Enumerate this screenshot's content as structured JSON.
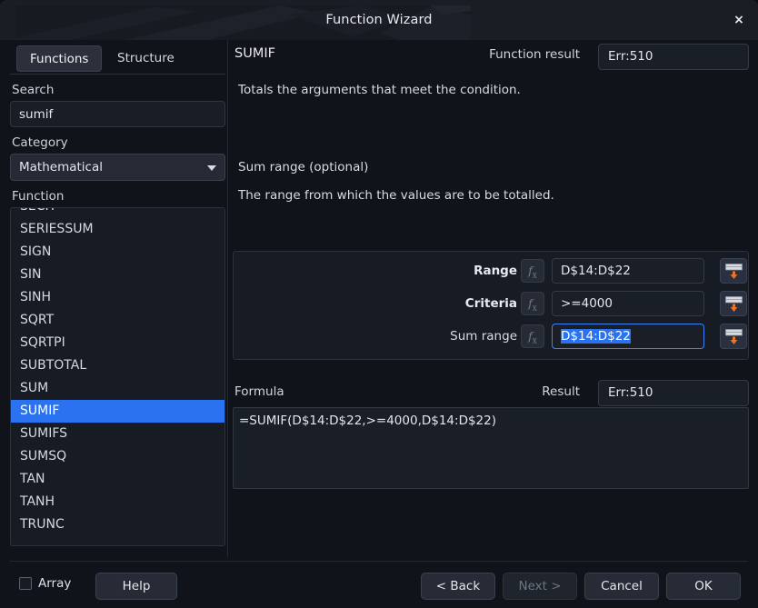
{
  "window": {
    "title": "Function Wizard",
    "close_label": "×"
  },
  "sidebar": {
    "tabs": [
      {
        "label": "Functions",
        "active": true
      },
      {
        "label": "Structure",
        "active": false
      }
    ],
    "search": {
      "label": "Search",
      "value": "sumif",
      "placeholder": ""
    },
    "category": {
      "label": "Category",
      "selected": "Mathematical"
    },
    "function_list": {
      "label": "Function",
      "selected": "SUMIF",
      "items": [
        "SECH",
        "SERIESSUM",
        "SIGN",
        "SIN",
        "SINH",
        "SQRT",
        "SQRTPI",
        "SUBTOTAL",
        "SUM",
        "SUMIF",
        "SUMIFS",
        "SUMSQ",
        "TAN",
        "TANH",
        "TRUNC"
      ]
    }
  },
  "main": {
    "function_name": "SUMIF",
    "function_result_label": "Function result",
    "function_result_value": "Err:510",
    "description": "Totals the arguments that meet the condition.",
    "argument_title": "Sum range (optional)",
    "argument_description": "The range from which the values are to be totalled.",
    "arguments": [
      {
        "label": "Range",
        "required": true,
        "value": "D$14:D$22",
        "focused": false,
        "fx_label": "fx",
        "picker_name": "select-range-button"
      },
      {
        "label": "Criteria",
        "required": true,
        "value": ">=4000",
        "focused": false,
        "fx_label": "fx",
        "picker_name": "select-range-button"
      },
      {
        "label": "Sum range",
        "required": false,
        "value": "D$14:D$22",
        "focused": true,
        "fx_label": "fx",
        "picker_name": "select-range-button"
      }
    ],
    "formula_label": "Formula",
    "formula_value": "=SUMIF(D$14:D$22,>=4000,D$14:D$22)",
    "result_label": "Result",
    "result_value": "Err:510"
  },
  "footer": {
    "array_label": "Array",
    "array_checked": false,
    "help_label": "Help",
    "back_label": "< Back",
    "next_label": "Next >",
    "next_disabled": true,
    "cancel_label": "Cancel",
    "ok_label": "OK"
  },
  "colors": {
    "accent_selection": "#2a72f0",
    "focus_border": "#3b82f6",
    "window_bg": "#10131a",
    "titlebar_bg": "#1a1d24",
    "field_bg": "#1a1e27",
    "picker_arrow": "#e8742a"
  }
}
